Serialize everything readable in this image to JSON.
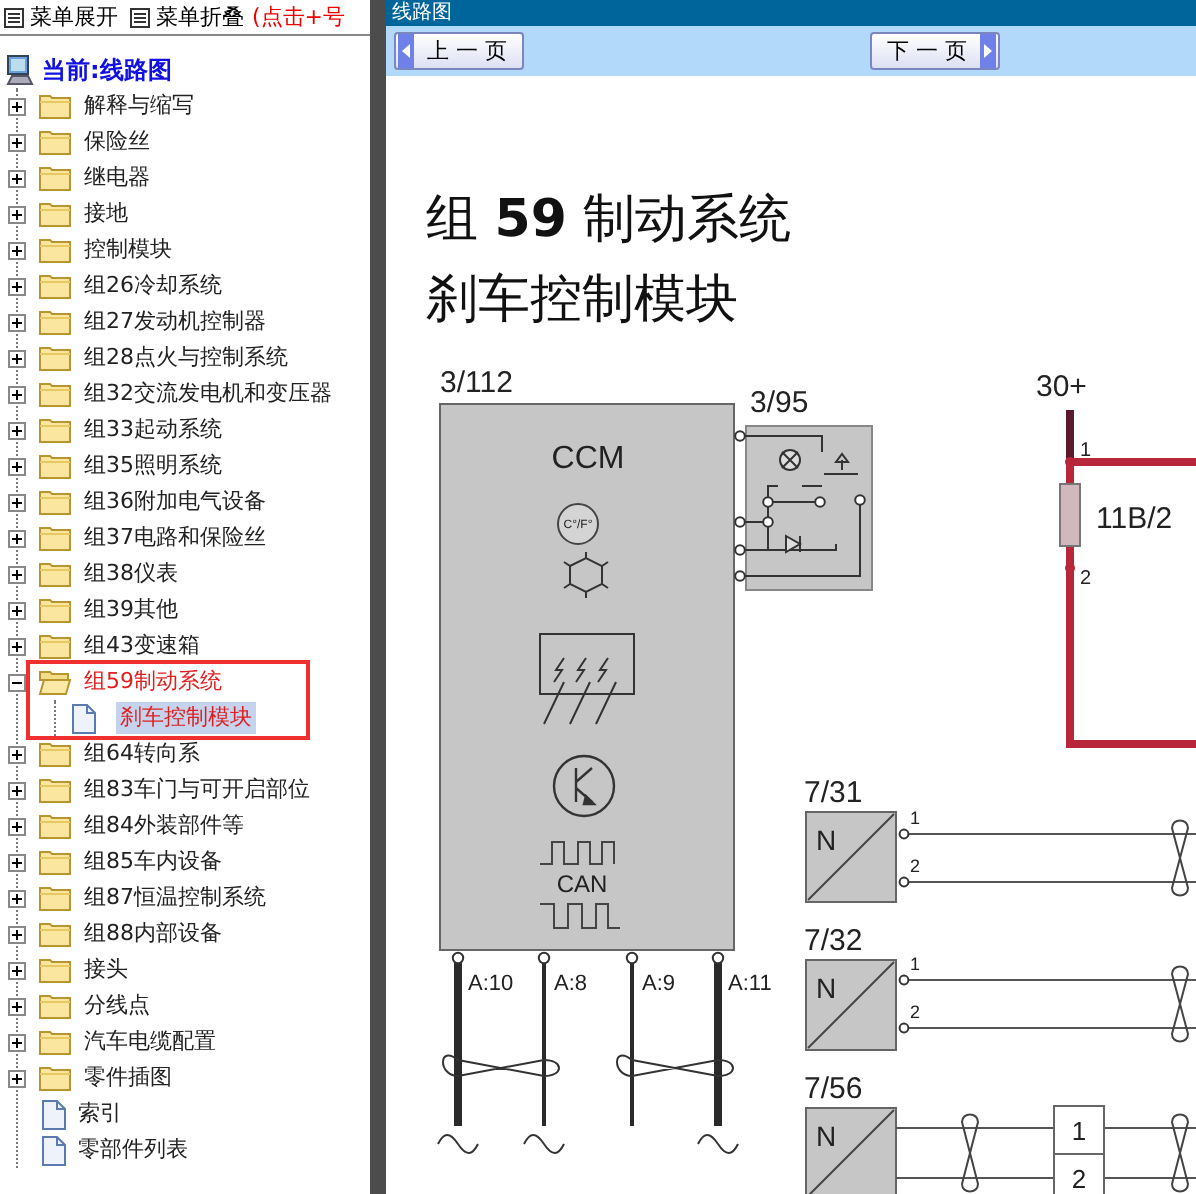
{
  "menu_bar": {
    "items": [
      {
        "label": "菜单展开"
      },
      {
        "label": "菜单折叠"
      }
    ],
    "hint": "(点击+号"
  },
  "tree": {
    "root": {
      "label": "当前:线路图"
    },
    "items": [
      {
        "kind": "folder",
        "label": "解释与缩写",
        "expanded": false,
        "selected": false
      },
      {
        "kind": "folder",
        "label": "保险丝",
        "expanded": false,
        "selected": false
      },
      {
        "kind": "folder",
        "label": "继电器",
        "expanded": false,
        "selected": false
      },
      {
        "kind": "folder",
        "label": "接地",
        "expanded": false,
        "selected": false
      },
      {
        "kind": "folder",
        "label": "控制模块",
        "expanded": false,
        "selected": false
      },
      {
        "kind": "folder",
        "label": "组26冷却系统",
        "expanded": false,
        "selected": false
      },
      {
        "kind": "folder",
        "label": "组27发动机控制器",
        "expanded": false,
        "selected": false
      },
      {
        "kind": "folder",
        "label": "组28点火与控制系统",
        "expanded": false,
        "selected": false
      },
      {
        "kind": "folder",
        "label": "组32交流发电机和变压器",
        "expanded": false,
        "selected": false
      },
      {
        "kind": "folder",
        "label": "组33起动系统",
        "expanded": false,
        "selected": false
      },
      {
        "kind": "folder",
        "label": "组35照明系统",
        "expanded": false,
        "selected": false
      },
      {
        "kind": "folder",
        "label": "组36附加电气设备",
        "expanded": false,
        "selected": false
      },
      {
        "kind": "folder",
        "label": "组37电路和保险丝",
        "expanded": false,
        "selected": false
      },
      {
        "kind": "folder",
        "label": "组38仪表",
        "expanded": false,
        "selected": false
      },
      {
        "kind": "folder",
        "label": "组39其他",
        "expanded": false,
        "selected": false
      },
      {
        "kind": "folder",
        "label": "组43变速箱",
        "expanded": false,
        "selected": false
      },
      {
        "kind": "folder",
        "label": "组59制动系统",
        "expanded": true,
        "selected": false,
        "highlighted": true,
        "children": [
          {
            "kind": "page",
            "label": "刹车控制模块",
            "selected": true
          }
        ]
      },
      {
        "kind": "folder",
        "label": "组64转向系",
        "expanded": false,
        "selected": false
      },
      {
        "kind": "folder",
        "label": "组83车门与可开启部位",
        "expanded": false,
        "selected": false
      },
      {
        "kind": "folder",
        "label": "组84外装部件等",
        "expanded": false,
        "selected": false
      },
      {
        "kind": "folder",
        "label": "组85车内设备",
        "expanded": false,
        "selected": false
      },
      {
        "kind": "folder",
        "label": "组87恒温控制系统",
        "expanded": false,
        "selected": false
      },
      {
        "kind": "folder",
        "label": "组88内部设备",
        "expanded": false,
        "selected": false
      },
      {
        "kind": "folder",
        "label": "接头",
        "expanded": false,
        "selected": false
      },
      {
        "kind": "folder",
        "label": "分线点",
        "expanded": false,
        "selected": false
      },
      {
        "kind": "folder",
        "label": "汽车电缆配置",
        "expanded": false,
        "selected": false
      },
      {
        "kind": "folder",
        "label": "零件插图",
        "expanded": false,
        "selected": false
      },
      {
        "kind": "page",
        "label": "索引",
        "selected": false
      },
      {
        "kind": "page",
        "label": "零部件列表",
        "selected": false
      }
    ]
  },
  "content": {
    "header": "线路图",
    "nav": [
      {
        "kind": "prev",
        "label": "上 一 页"
      },
      {
        "kind": "next",
        "label": "下 一 页"
      }
    ],
    "title": [
      "组 **59** 制动系统",
      "刹车控制模块"
    ],
    "diagram": {
      "module": {
        "ref": "3/112",
        "name": "CCM",
        "temp_unit": "C°/F°",
        "bus": "CAN",
        "pins": [
          "A:10",
          "A:8",
          "A:9",
          "A:11"
        ]
      },
      "switch_unit": {
        "ref": "3/95"
      },
      "supply": {
        "ref": "30+",
        "fuse": "11B/2",
        "pin_in": "1",
        "pin_out": "2"
      },
      "sensors": [
        {
          "ref": "7/31",
          "symbol": "N",
          "pins": [
            "1",
            "2"
          ]
        },
        {
          "ref": "7/32",
          "symbol": "N",
          "pins": [
            "1",
            "2"
          ]
        },
        {
          "ref": "7/56",
          "symbol": "N"
        }
      ],
      "connector": {
        "pins": [
          "1",
          "2"
        ]
      }
    }
  }
}
